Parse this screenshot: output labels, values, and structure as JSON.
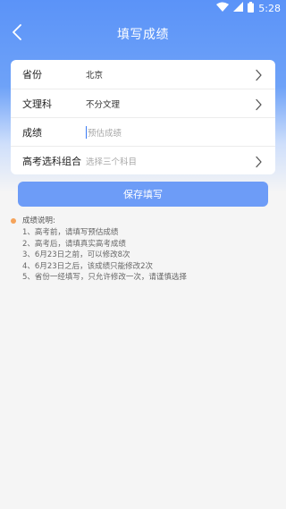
{
  "status_bar": {
    "time": "5:28",
    "icons": [
      "wifi-icon",
      "signal-icon",
      "battery-icon"
    ]
  },
  "header": {
    "title": "填写成绩",
    "back_icon": "chevron-left-icon"
  },
  "form": {
    "rows": [
      {
        "label": "省份",
        "value": "北京",
        "placeholder": "",
        "has_arrow": true
      },
      {
        "label": "文理科",
        "value": "不分文理",
        "placeholder": "",
        "has_arrow": true
      },
      {
        "label": "成绩",
        "value": "",
        "placeholder": "预估成绩",
        "has_arrow": false
      },
      {
        "label": "高考选科组合",
        "value": "",
        "placeholder": "选择三个科目",
        "has_arrow": true
      }
    ]
  },
  "actions": {
    "save_label": "保存填写"
  },
  "notes": {
    "title": "成绩说明:",
    "items": [
      "1、高考前，请填写预估成绩",
      "2、高考后，请填真实高考成绩",
      "3、6月23日之前，可以修改8次",
      "4、6月23日之后，该成绩只能修改2次",
      "5、省份一经填写，只允许修改一次，请谨慎选择"
    ]
  },
  "colors": {
    "primary": "#5b93f8",
    "button": "#6d9cf7",
    "dot": "#f5a35a",
    "background": "#f5f5f5"
  }
}
